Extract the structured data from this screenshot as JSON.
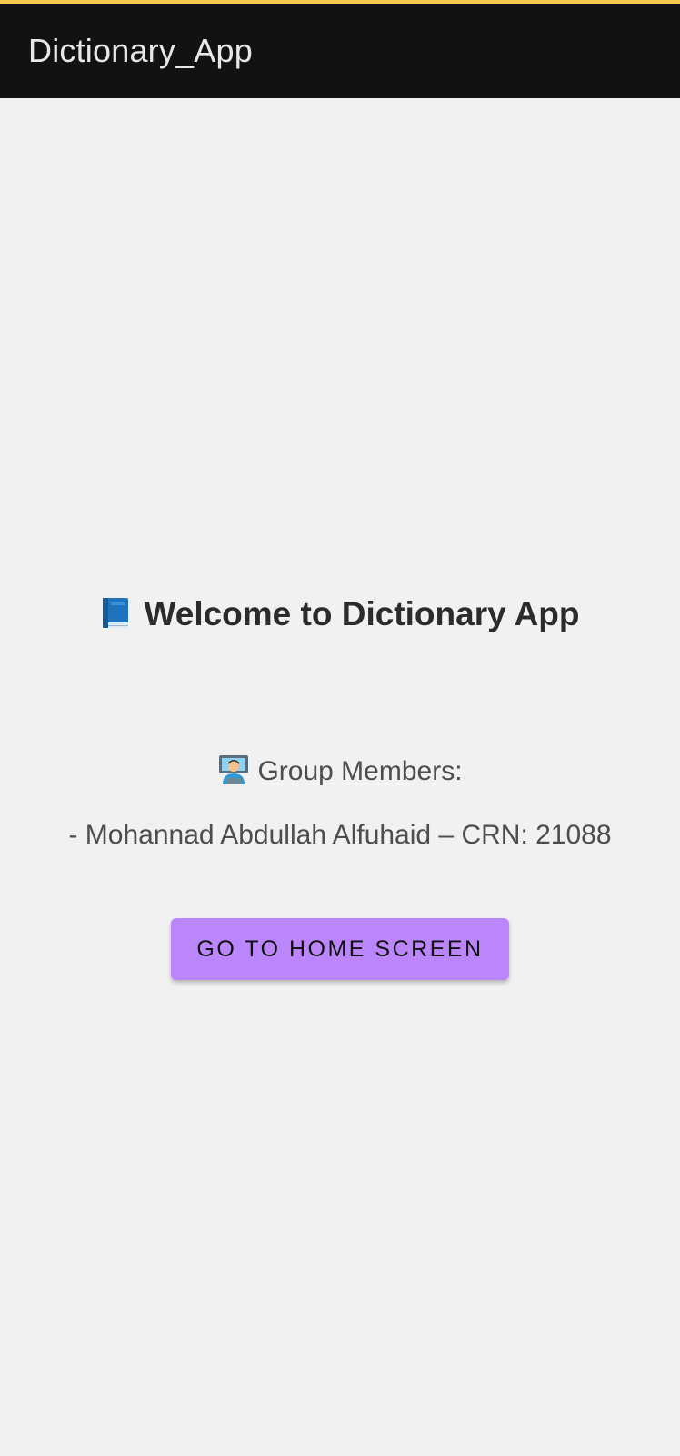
{
  "app_bar": {
    "title": "Dictionary_App",
    "background": "#121212",
    "accent": "#f2c94c"
  },
  "main": {
    "welcome_icon": "blue-book-icon",
    "welcome_text": "Welcome to Dictionary App",
    "members_icon": "technologist-icon",
    "members_heading": "Group Members:",
    "members": [
      "- Mohannad Abdullah Alfuhaid – CRN: 21088"
    ],
    "button_label": "GO TO HOME SCREEN",
    "button_color": "#bb86fc"
  }
}
